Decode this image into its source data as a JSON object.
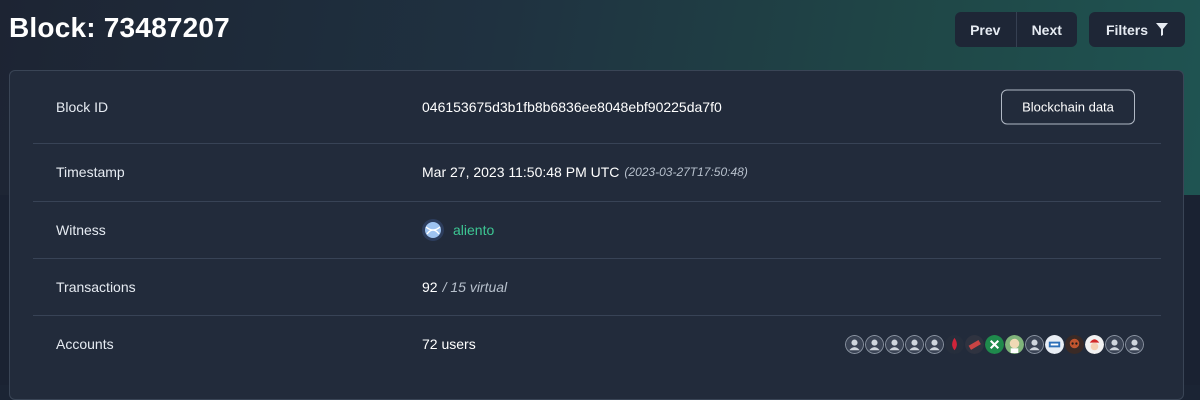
{
  "page": {
    "title": "Block: 73487207"
  },
  "nav": {
    "prev_label": "Prev",
    "next_label": "Next",
    "filters_label": "Filters",
    "filter_icon": "funnel-icon"
  },
  "block": {
    "id_label": "Block ID",
    "id_value": "046153675d3b1fb8b6836ee8048ebf90225da7f0",
    "blockchain_data_label": "Blockchain data",
    "timestamp_label": "Timestamp",
    "timestamp_value": "Mar 27, 2023 11:50:48 PM UTC",
    "timestamp_iso": "(2023-03-27T17:50:48)",
    "witness_label": "Witness",
    "witness_name": "aliento",
    "transactions_label": "Transactions",
    "transactions_count": "92",
    "transactions_virtual": "/ 15 virtual",
    "accounts_label": "Accounts",
    "accounts_value": "72 users"
  },
  "colors": {
    "accent_green": "#3dc693",
    "background": "#1a2232",
    "card": "#222b3b"
  },
  "account_avatars": [
    "default-user-icon",
    "default-user-icon",
    "default-user-icon",
    "default-user-icon",
    "default-user-icon",
    "red-drop-avatar",
    "flag-avatar",
    "green-x-avatar",
    "face-avatar",
    "default-user-icon",
    "vote-avatar",
    "dark-character-avatar",
    "red-white-character-avatar",
    "default-user-icon",
    "default-user-icon"
  ]
}
